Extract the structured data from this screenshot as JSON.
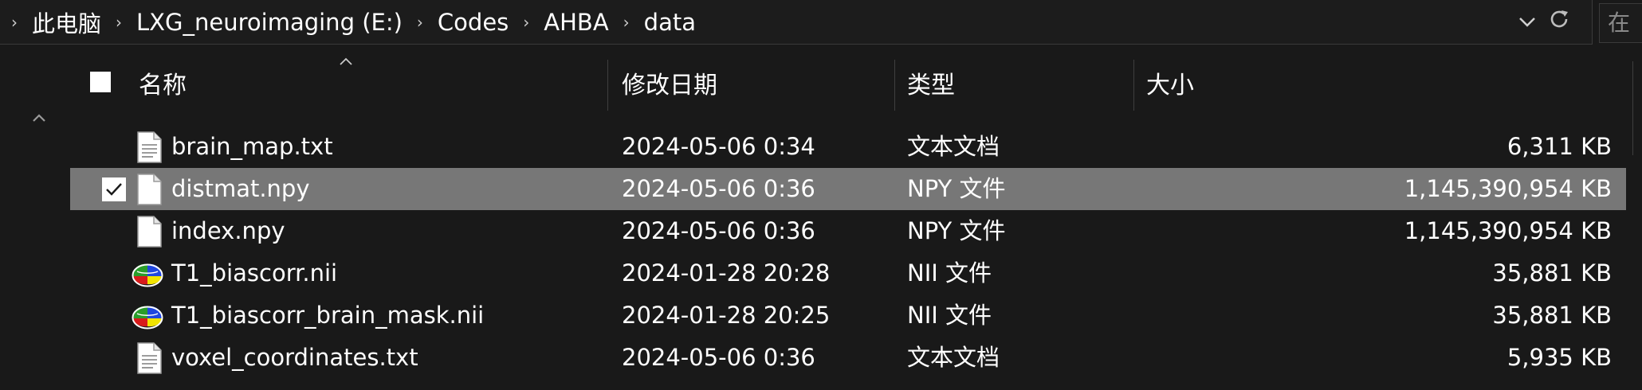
{
  "breadcrumb": {
    "items": [
      "此电脑",
      "LXG_neuroimaging (E:)",
      "Codes",
      "AHBA",
      "data"
    ],
    "separator": "›"
  },
  "search": {
    "partial_label": "在"
  },
  "columns": {
    "name": "名称",
    "modified": "修改日期",
    "type": "类型",
    "size": "大小"
  },
  "files": [
    {
      "name": "brain_map.txt",
      "date": "2024-05-06 0:34",
      "type": "文本文档",
      "size": "6,311 KB",
      "icon": "text-file-icon",
      "selected": false
    },
    {
      "name": "distmat.npy",
      "date": "2024-05-06 0:36",
      "type": "NPY 文件",
      "size": "1,145,390,954 KB",
      "icon": "generic-file-icon",
      "selected": true
    },
    {
      "name": "index.npy",
      "date": "2024-05-06 0:36",
      "type": "NPY 文件",
      "size": "1,145,390,954 KB",
      "icon": "generic-file-icon",
      "selected": false
    },
    {
      "name": "T1_biascorr.nii",
      "date": "2024-01-28 20:28",
      "type": "NII 文件",
      "size": "35,881 KB",
      "icon": "brain-file-icon",
      "selected": false
    },
    {
      "name": "T1_biascorr_brain_mask.nii",
      "date": "2024-01-28 20:25",
      "type": "NII 文件",
      "size": "35,881 KB",
      "icon": "brain-file-icon",
      "selected": false
    },
    {
      "name": "voxel_coordinates.txt",
      "date": "2024-05-06 0:36",
      "type": "文本文档",
      "size": "5,935 KB",
      "icon": "text-file-icon",
      "selected": false
    }
  ],
  "colors": {
    "background": "#191919",
    "selected_row": "#777777",
    "text": "#ffffff"
  }
}
